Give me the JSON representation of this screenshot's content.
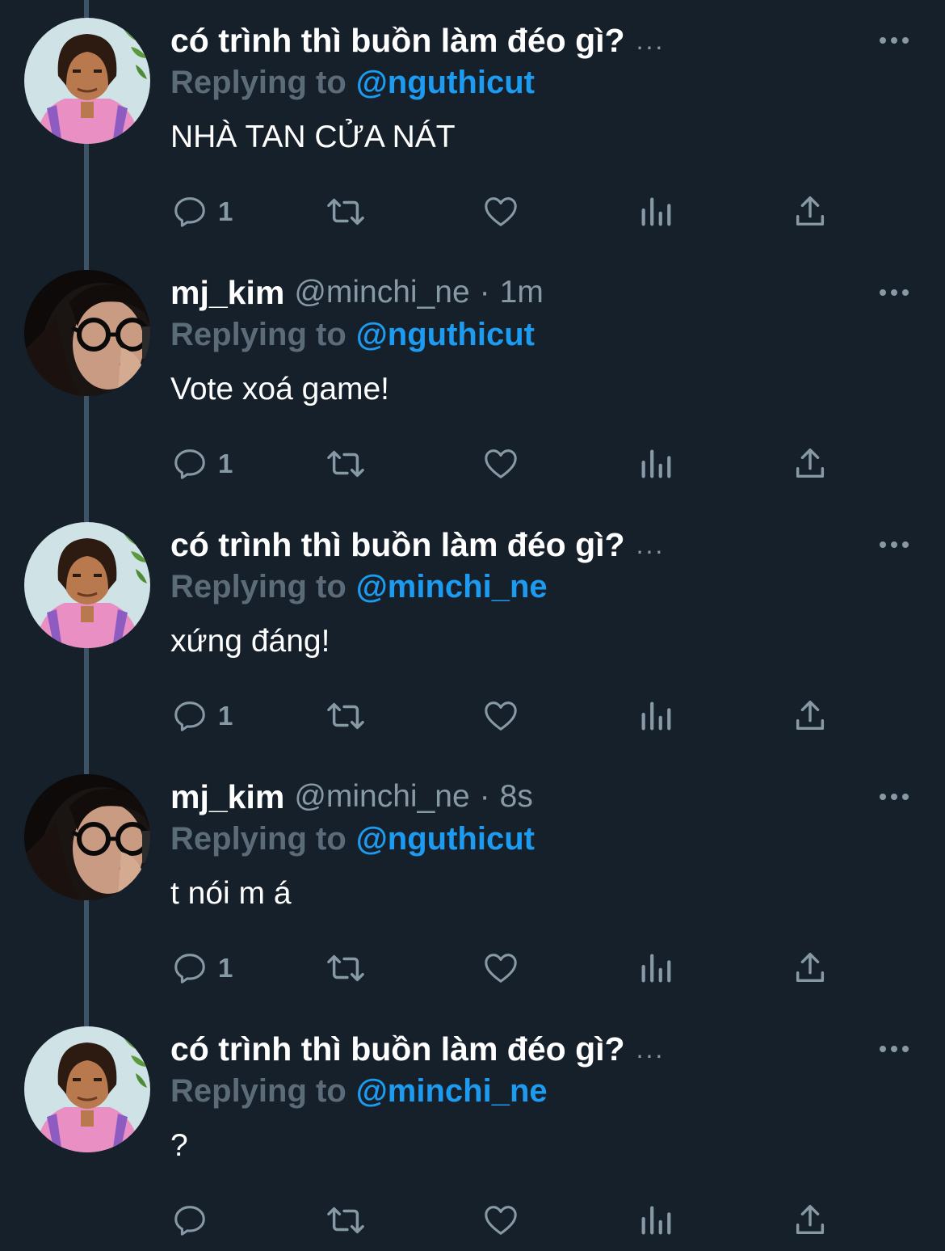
{
  "colors": {
    "background": "#15202b",
    "name": "#ffffff",
    "muted": "#8899a6",
    "replying_label": "#5b6b78",
    "link": "#1d9bf0",
    "thread_line": "#3d5466"
  },
  "tweets": [
    {
      "avatar": "dora-meme-avatar",
      "name": "có trình thì buồn làm đéo gì?",
      "ellipsis": "...",
      "handle": "",
      "time": "",
      "replying_label": "Replying to",
      "replying_to": "@nguthicut",
      "text": "NHÀ TAN CỬA NÁT",
      "reply_count": "1"
    },
    {
      "avatar": "girl-glasses-avatar",
      "name": "mj_kim",
      "ellipsis": "",
      "handle": "@minchi_ne",
      "sep": "·",
      "time": "1m",
      "replying_label": "Replying to",
      "replying_to": "@nguthicut",
      "text": "Vote xoá game!",
      "reply_count": "1"
    },
    {
      "avatar": "dora-meme-avatar",
      "name": "có trình thì buồn làm đéo gì?",
      "ellipsis": "...",
      "handle": "",
      "time": "",
      "replying_label": "Replying to",
      "replying_to": "@minchi_ne",
      "text": "xứng đáng!",
      "reply_count": "1"
    },
    {
      "avatar": "girl-glasses-avatar",
      "name": "mj_kim",
      "ellipsis": "",
      "handle": "@minchi_ne",
      "sep": "·",
      "time": "8s",
      "replying_label": "Replying to",
      "replying_to": "@nguthicut",
      "text": "t nói m á",
      "reply_count": "1"
    },
    {
      "avatar": "dora-meme-avatar",
      "name": "có trình thì buồn làm đéo gì?",
      "ellipsis": "...",
      "handle": "",
      "time": "",
      "replying_label": "Replying to",
      "replying_to": "@minchi_ne",
      "text": "?",
      "reply_count": ""
    }
  ]
}
